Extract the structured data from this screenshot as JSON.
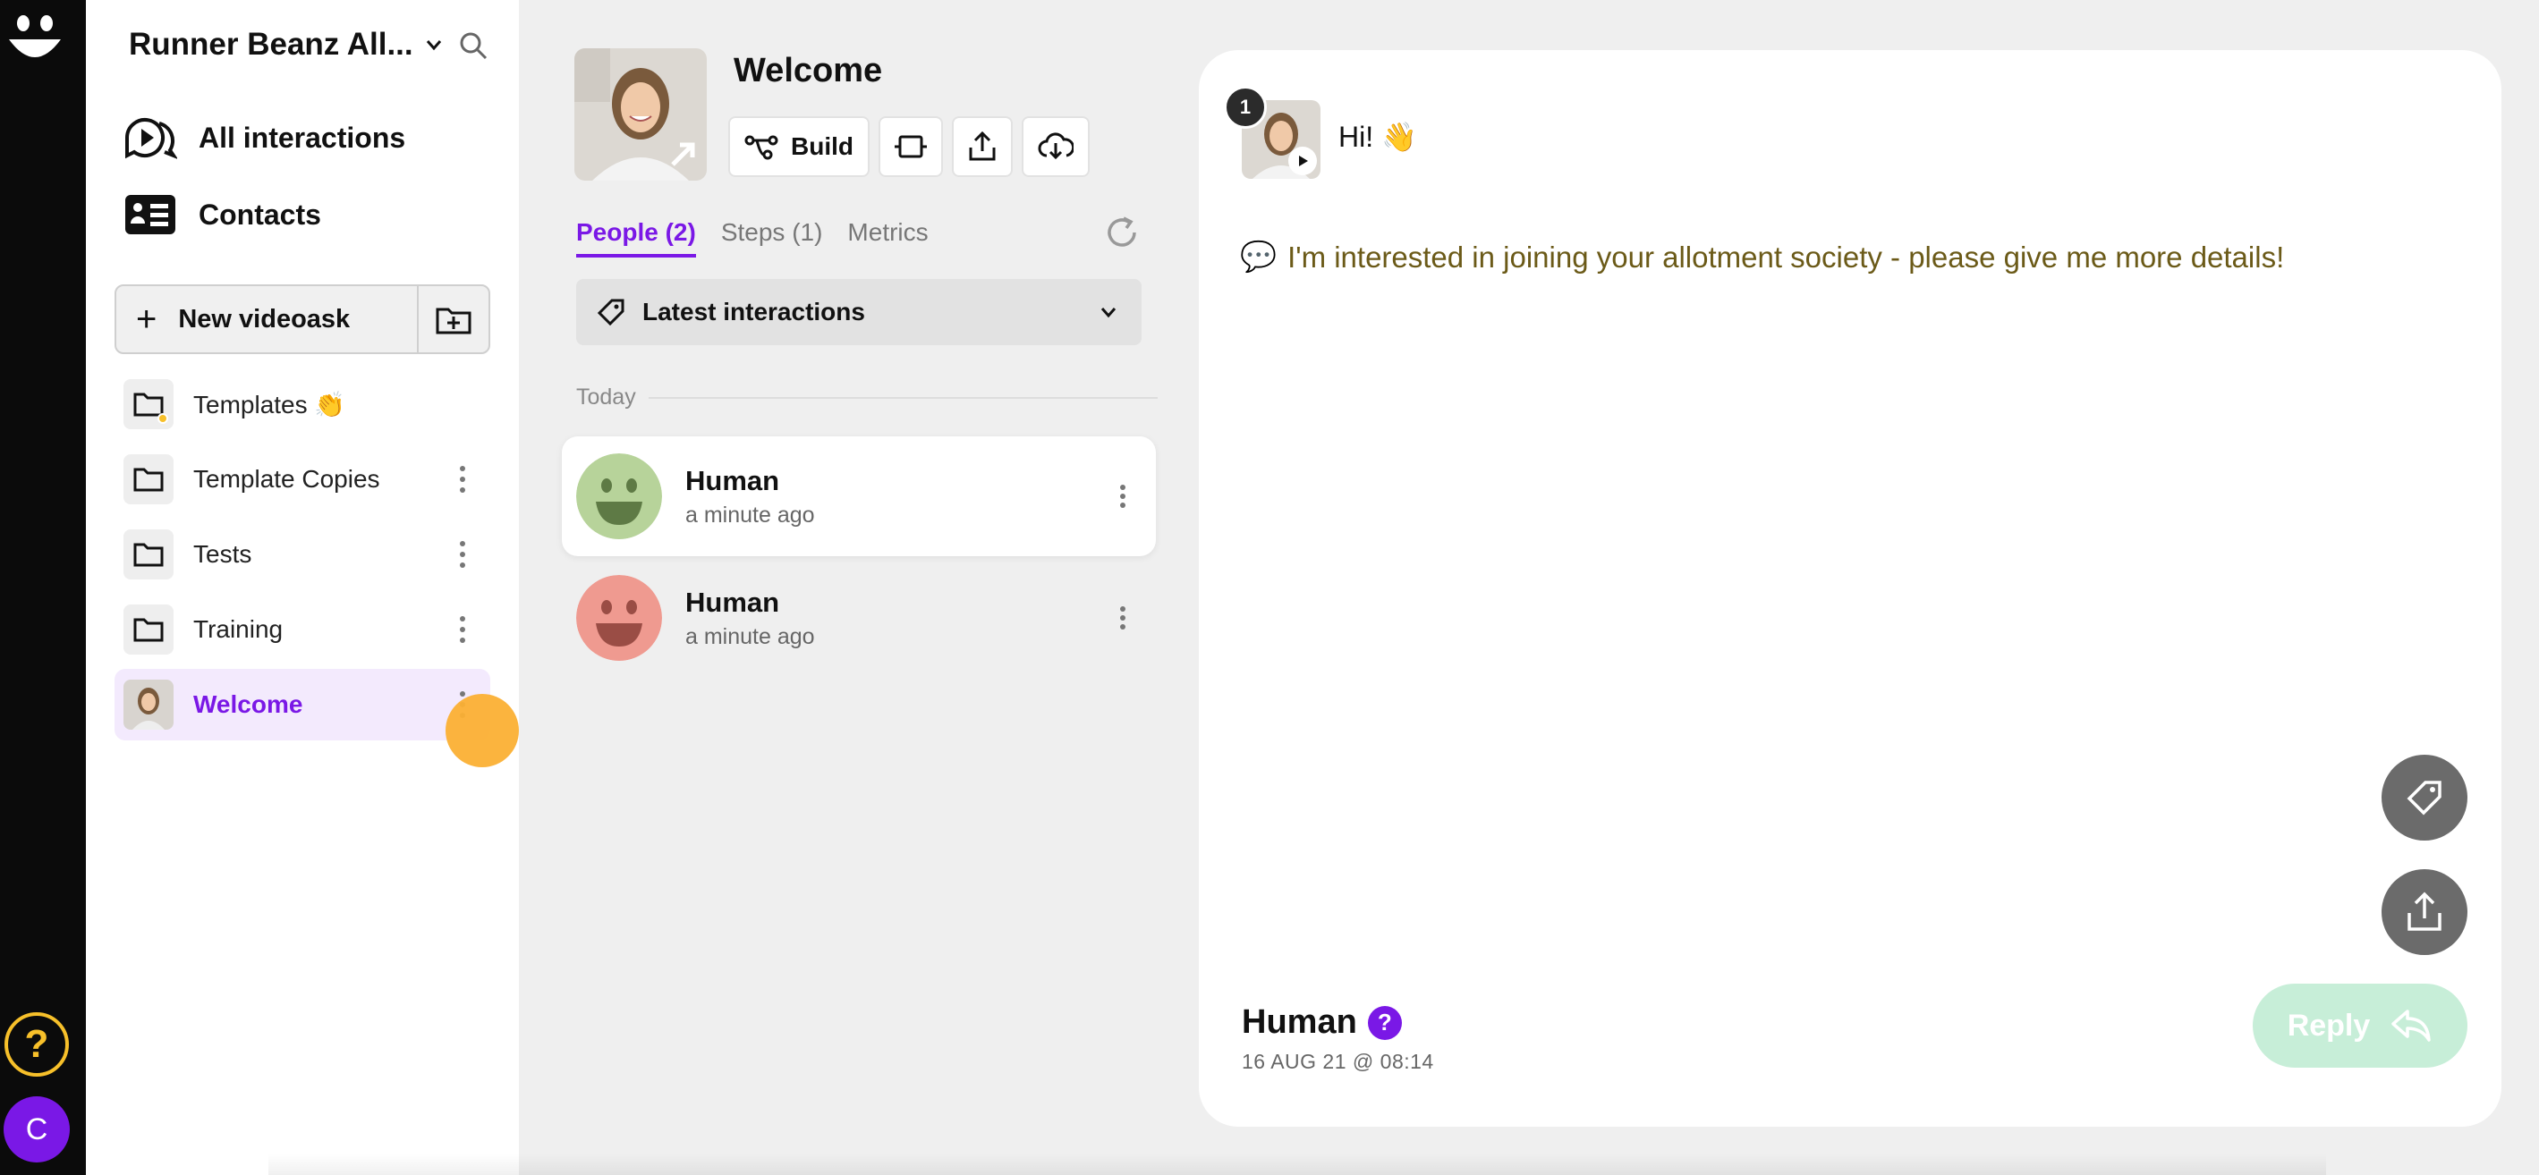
{
  "colors": {
    "brand_purple": "#7a18e6",
    "accent_yellow": "#f7c02a",
    "cursor_orange": "#fbb034",
    "reply_green": "#c7eed8"
  },
  "rail": {
    "help_label": "?",
    "user_initial": "C"
  },
  "workspace": {
    "title": "Runner Beanz All..."
  },
  "nav": {
    "all_interactions": "All interactions",
    "contacts": "Contacts"
  },
  "new_videoask": {
    "plus": "+",
    "label": "New videoask"
  },
  "folders": [
    {
      "name": "Templates",
      "emoji": "👏"
    },
    {
      "name": "Template Copies"
    },
    {
      "name": "Tests"
    },
    {
      "name": "Training"
    },
    {
      "name": "Welcome"
    }
  ],
  "videoask": {
    "title": "Welcome",
    "build_label": "Build"
  },
  "tabs": [
    {
      "label": "People (2)"
    },
    {
      "label": "Steps (1)"
    },
    {
      "label": "Metrics"
    }
  ],
  "filter": {
    "label": "Latest interactions"
  },
  "group_label": "Today",
  "people": [
    {
      "name": "Human",
      "time": "a minute ago"
    },
    {
      "name": "Human",
      "time": "a minute ago"
    }
  ],
  "detail": {
    "step_number": "1",
    "step_label": "Hi! 👋",
    "answer_icon": "💬",
    "answer_text": "I'm interested in joining your allotment society - please give me more details!",
    "contact_name": "Human",
    "contact_badge": "?",
    "date": "16 AUG 21 @ 08:14",
    "reply_label": "Reply"
  }
}
